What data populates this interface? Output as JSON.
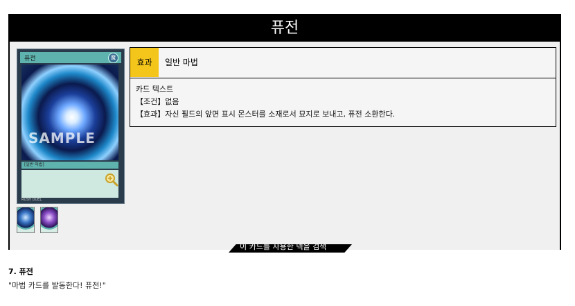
{
  "panel": {
    "title": "퓨전"
  },
  "card": {
    "name": "퓨전",
    "attribute": "魔",
    "watermark": "SAMPLE",
    "type_line": "[일반 마법]",
    "zoom_icon": "magnifier-plus-icon",
    "footer": "RUSH DUEL"
  },
  "thumbnails": [
    "card-thumb-1",
    "card-thumb-2"
  ],
  "info": {
    "effect_label": "효과",
    "effect_type": "일반 마법",
    "text_header": "카드 텍스트",
    "condition": "【조건】없음",
    "effect": "【효과】자신 필드의 앞면 표시 몬스터를 소재로서 묘지로 보내고, 퓨전 소환한다."
  },
  "banner": {
    "text": "이 카드를 사용한 덱을 검색"
  },
  "below": {
    "title": "7. 퓨전",
    "quote": "\"마법 카드를 발동한다! 퓨전!\""
  },
  "colors": {
    "panel_bg": "#f0f0f0",
    "title_bg": "#000000",
    "effect_label_bg": "#f4c51b",
    "card_frame": "#5fb3ae"
  }
}
